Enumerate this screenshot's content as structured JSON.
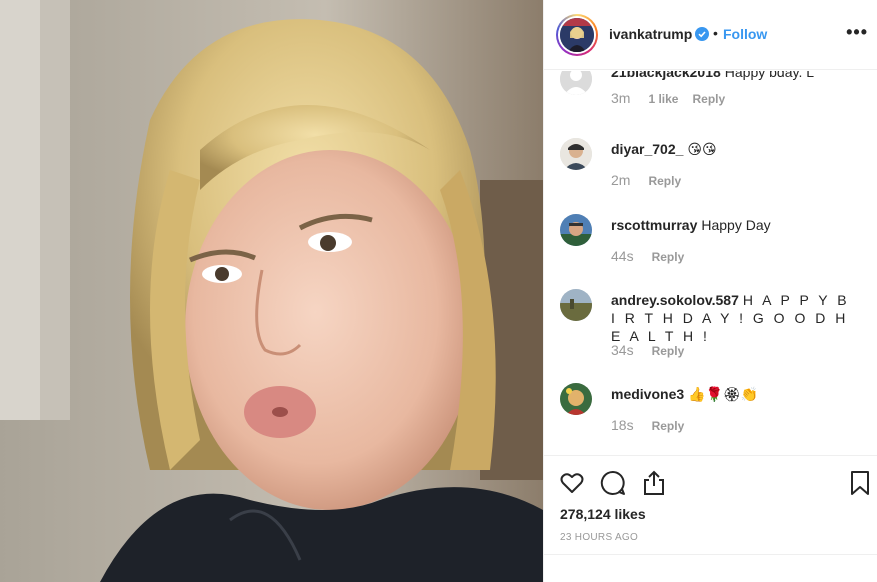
{
  "post": {
    "username": "ivankatrump",
    "follow_label": "Follow",
    "dot": "•",
    "more_label": "•••"
  },
  "comments": [
    {
      "user": "21blackjack2018",
      "text": "Happy bday. L",
      "time": "3m",
      "likes": "1 like",
      "reply": "Reply"
    },
    {
      "user": "diyar_702_",
      "text": "😘😘",
      "time": "2m",
      "likes": "",
      "reply": "Reply"
    },
    {
      "user": "rscottmurray",
      "text": "Happy Day",
      "time": "44s",
      "likes": "",
      "reply": "Reply"
    },
    {
      "user": "andrey.sokolov.587",
      "text": "H A P P Y B I R T H D A Y ! G O O D H E A L T H !",
      "time": "34s",
      "likes": "",
      "reply": "Reply"
    },
    {
      "user": "medivone3",
      "text": "👍🌹🏵👏",
      "time": "18s",
      "likes": "",
      "reply": "Reply"
    }
  ],
  "actions": {
    "likes_count": "278,124 likes",
    "posted": "23 HOURS AGO"
  },
  "icons": {
    "like": "heart-icon",
    "comment": "comment-icon",
    "share": "share-icon",
    "save": "bookmark-icon",
    "verified": "verified-badge-icon"
  },
  "colors": {
    "accent": "#3897f0",
    "text": "#262626",
    "muted": "#999999",
    "divider": "#efefef"
  }
}
